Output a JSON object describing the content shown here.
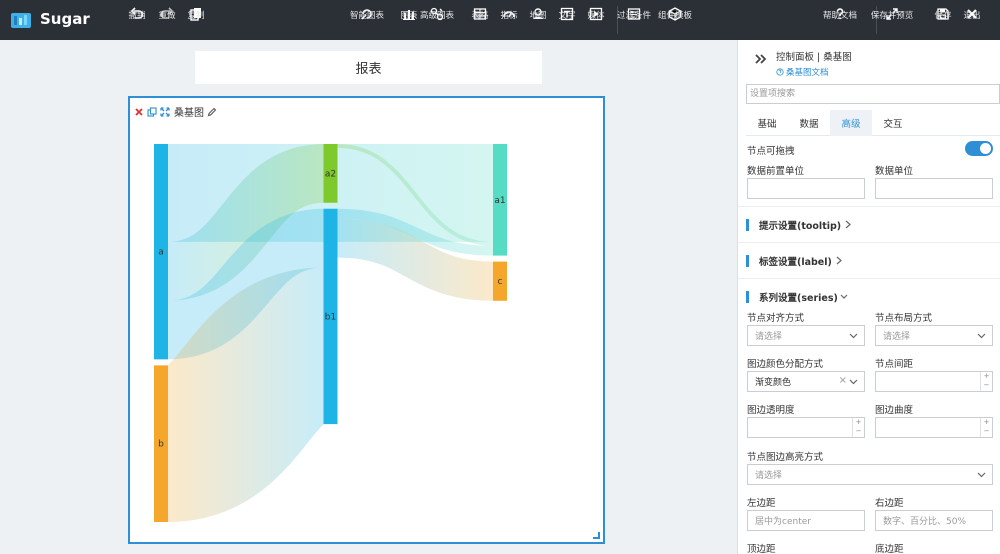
{
  "app": {
    "brand": "Sugar"
  },
  "toolbar": {
    "left": [
      {
        "label": "撤销",
        "icon": "undo-icon"
      },
      {
        "label": "重做",
        "icon": "redo-icon"
      },
      {
        "label": "复制",
        "icon": "copy-icon"
      }
    ],
    "center": [
      {
        "label": "智能图表",
        "icon": "smart-chart-icon"
      },
      {
        "label": "图表",
        "icon": "bar-chart-icon"
      },
      {
        "label": "高级图表",
        "icon": "advanced-chart-icon"
      },
      {
        "label": "表格",
        "icon": "table-icon"
      },
      {
        "label": "指标",
        "icon": "gauge-icon"
      },
      {
        "label": "地图",
        "icon": "map-icon"
      },
      {
        "label": "文字",
        "icon": "text-icon"
      },
      {
        "label": "媒体",
        "icon": "media-icon"
      },
      {
        "label": "过滤条件",
        "icon": "filter-icon"
      },
      {
        "label": "组件模板",
        "icon": "template-icon"
      }
    ],
    "right": [
      {
        "label": "帮助文档",
        "icon": "help-icon"
      },
      {
        "label": "保存并预览",
        "icon": "preview-icon"
      },
      {
        "label": "保存",
        "icon": "save-icon"
      },
      {
        "label": "退出",
        "icon": "exit-icon"
      }
    ]
  },
  "canvas": {
    "report_title": "报表",
    "chart_name": "桑基图"
  },
  "chart_data": {
    "type": "sankey",
    "nodes": [
      {
        "name": "a",
        "color": "#1fb4e6"
      },
      {
        "name": "b",
        "color": "#f4a72a"
      },
      {
        "name": "a2",
        "color": "#7ec92b"
      },
      {
        "name": "b1",
        "color": "#1fb4e6"
      },
      {
        "name": "a1",
        "color": "#56dbc4"
      },
      {
        "name": "c",
        "color": "#f4a72a"
      }
    ],
    "links": [
      {
        "source": "a",
        "target": "a1",
        "value": 5
      },
      {
        "source": "a",
        "target": "a2",
        "value": 3
      },
      {
        "source": "a",
        "target": "b1",
        "value": 3
      },
      {
        "source": "b",
        "target": "b1",
        "value": 8
      },
      {
        "source": "a2",
        "target": "a1",
        "value": 0.2
      },
      {
        "source": "b1",
        "target": "a1",
        "value": 0.5
      },
      {
        "source": "b1",
        "target": "c",
        "value": 2
      }
    ]
  },
  "panel": {
    "title": "控制面板 | 桑基图",
    "doc_link": "桑基图文档",
    "search_placeholder": "设置项搜索",
    "tabs": [
      "基础",
      "数据",
      "高级",
      "交互"
    ],
    "active_tab": "高级",
    "draggable_label": "节点可拖拽",
    "prefix_unit_label": "数据前置单位",
    "unit_label": "数据单位",
    "tooltip_section": "提示设置(tooltip)",
    "label_section": "标签设置(label)",
    "series_section": "系列设置(series)",
    "node_align_label": "节点对齐方式",
    "node_align_value": "请选择",
    "node_layout_label": "节点布局方式",
    "node_layout_value": "请选择",
    "edge_color_label": "图边颜色分配方式",
    "edge_color_value": "渐变颜色",
    "node_gap_label": "节点间距",
    "edge_opacity_label": "图边透明度",
    "edge_curve_label": "图边曲度",
    "highlight_label": "节点图边高亮方式",
    "highlight_value": "请选择",
    "left_margin_label": "左边距",
    "left_margin_placeholder": "居中为center",
    "right_margin_label": "右边距",
    "right_margin_placeholder": "数字、百分比、50%",
    "top_margin_label": "顶边距",
    "bottom_margin_label": "底边距"
  }
}
